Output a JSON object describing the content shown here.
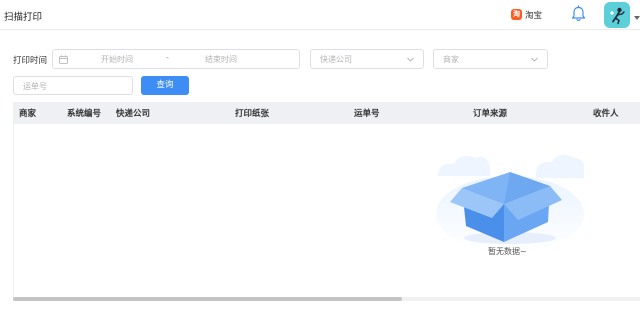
{
  "header": {
    "title": "扫描打印",
    "platform": {
      "logo_text": "淘",
      "label": "淘宝"
    },
    "icons": {
      "notification": "bell-icon",
      "avatar": "user-avatar",
      "menu": "caret-down-icon"
    }
  },
  "filters": {
    "print_time_label": "打印时间",
    "date_start_placeholder": "开始时间",
    "date_separator": "-",
    "date_end_placeholder": "结束时间",
    "express_company_placeholder": "快递公司",
    "merchant_placeholder": "商家",
    "tracking_number_placeholder": "运单号",
    "query_button": "查询"
  },
  "table": {
    "columns": [
      "商家",
      "系统编号",
      "快递公司",
      "打印纸张",
      "运单号",
      "订单来源",
      "收件人"
    ],
    "rows": [],
    "empty_text": "暂无数据~",
    "horizontal_scroll_fraction": 0.62
  },
  "colors": {
    "primary": "#3d8df5",
    "header_bg": "#eef0f4",
    "border": "#dcdfe6",
    "placeholder": "#b3b3b3",
    "platform": "#ff5a1f",
    "avatar_bg": "#5ccfd8"
  }
}
